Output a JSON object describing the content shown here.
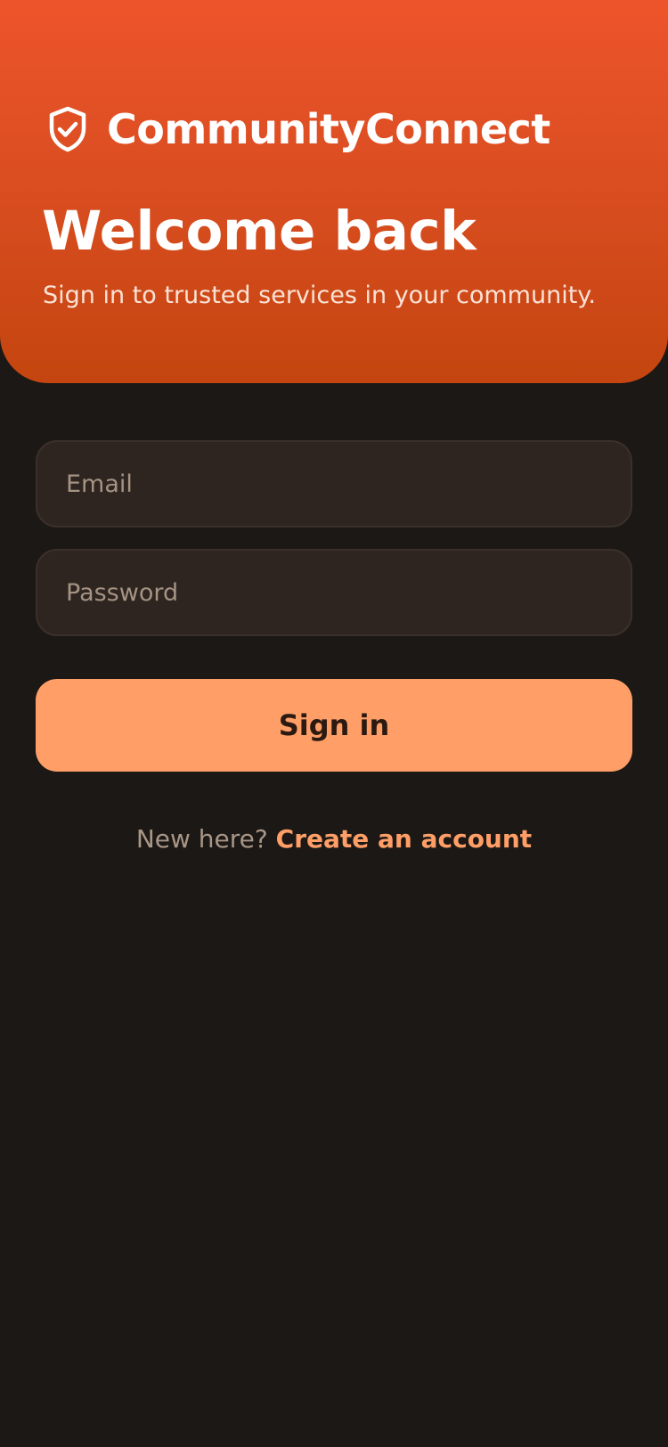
{
  "app": {
    "name": "CommunityConnect",
    "logo_icon": "shield-check-icon"
  },
  "hero": {
    "title": "Welcome back",
    "subtitle": "Sign in to trusted services in your community."
  },
  "form": {
    "email_placeholder": "Email",
    "email_value": "",
    "password_placeholder": "Password",
    "password_value": "",
    "submit_label": "Sign in"
  },
  "footer": {
    "prompt": "New here?",
    "link_label": "Create an account"
  },
  "colors": {
    "hero_gradient_top": "#ee542b",
    "hero_gradient_bottom": "#c4450f",
    "background": "#1c1815",
    "field_background": "#2e2520",
    "accent": "#ff9f67"
  }
}
